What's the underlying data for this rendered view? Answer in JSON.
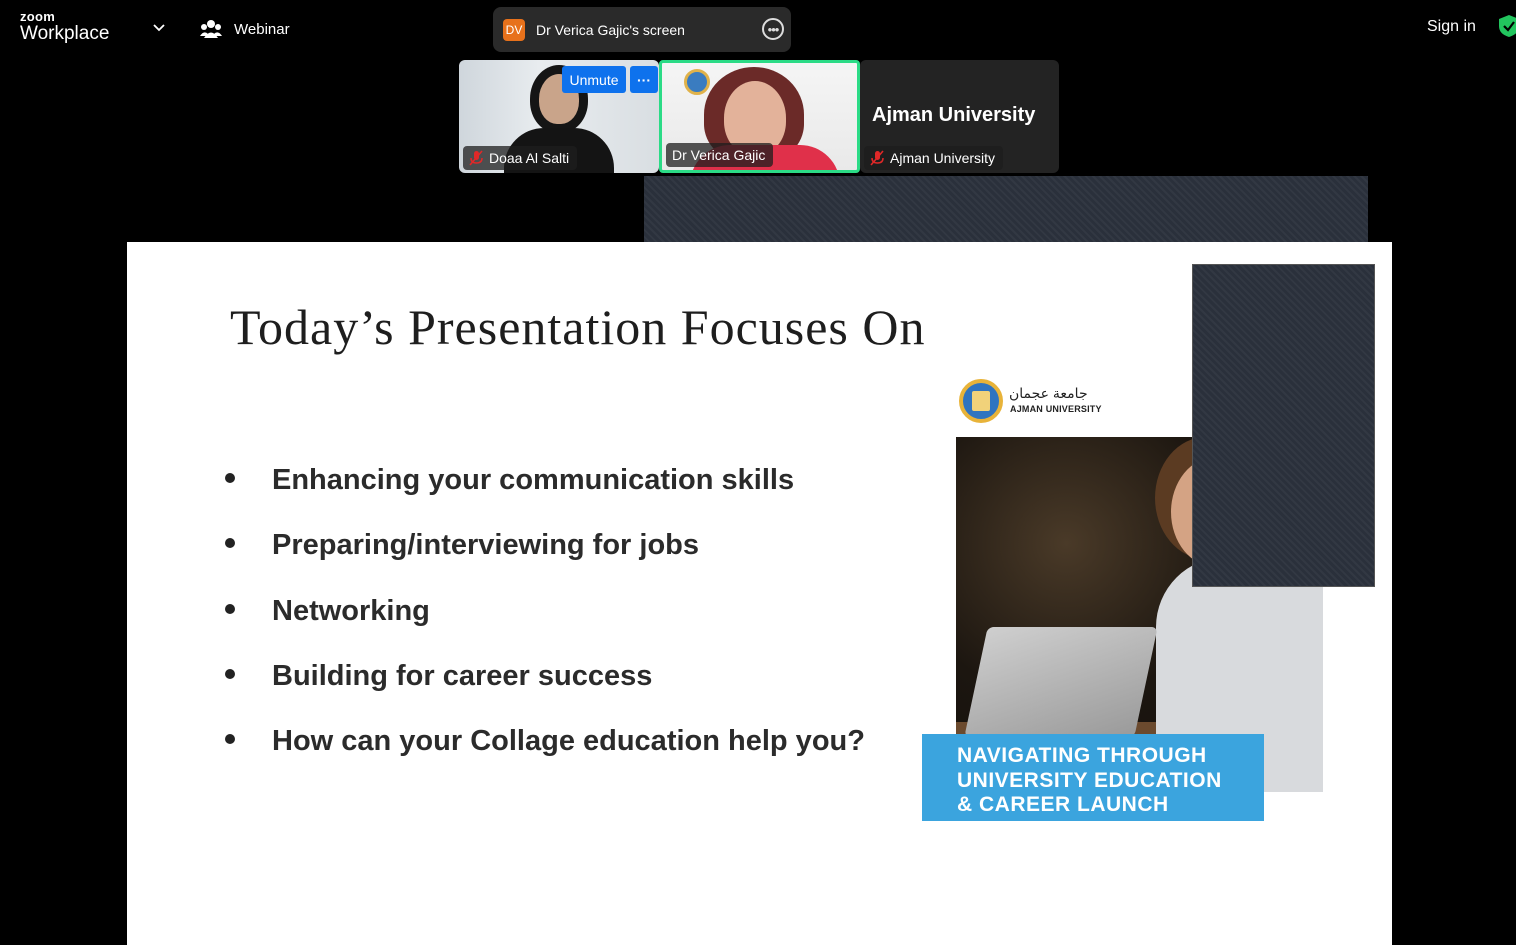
{
  "topbar": {
    "logo_small": "zoom",
    "logo_big": "Workplace",
    "webinar_label": "Webinar",
    "share_initials": "DV",
    "share_label": "Dr Verica Gajic's screen",
    "signin_label": "Sign in"
  },
  "participants": [
    {
      "name": "Doaa Al Salti",
      "muted": true
    },
    {
      "name": "Dr Verica Gajic",
      "muted": false,
      "active_speaker": true
    },
    {
      "name": "Ajman University",
      "muted": true,
      "display_text": "Ajman University"
    }
  ],
  "controls": {
    "unmute_label": "Unmute",
    "more_label": "···"
  },
  "slide": {
    "title": "Today’s Presentation Focuses On",
    "bullets": [
      "Enhancing your communication  skills",
      "Preparing/interviewing for jobs",
      "Networking",
      "Building for career success",
      "How can your Collage education help you?"
    ],
    "logo_arabic": "جامعة عجمان",
    "logo_english": "AJMAN UNIVERSITY",
    "banner_lines": [
      "NAVIGATING THROUGH",
      "UNIVERSITY EDUCATION",
      "& CAREER LAUNCH"
    ]
  },
  "colors": {
    "active_speaker_border": "#2bdb86",
    "button_blue": "#0e72ed",
    "banner_blue": "#3ba4de",
    "share_initials_bg": "#e7711b",
    "muted_red": "#e02828",
    "shield_green": "#22c55e"
  },
  "icons": {
    "webinar": "people-icon",
    "chevron": "chevron-down-icon",
    "more": "more-horizontal-icon",
    "security": "shield-check-icon",
    "mute": "mic-off-icon"
  }
}
